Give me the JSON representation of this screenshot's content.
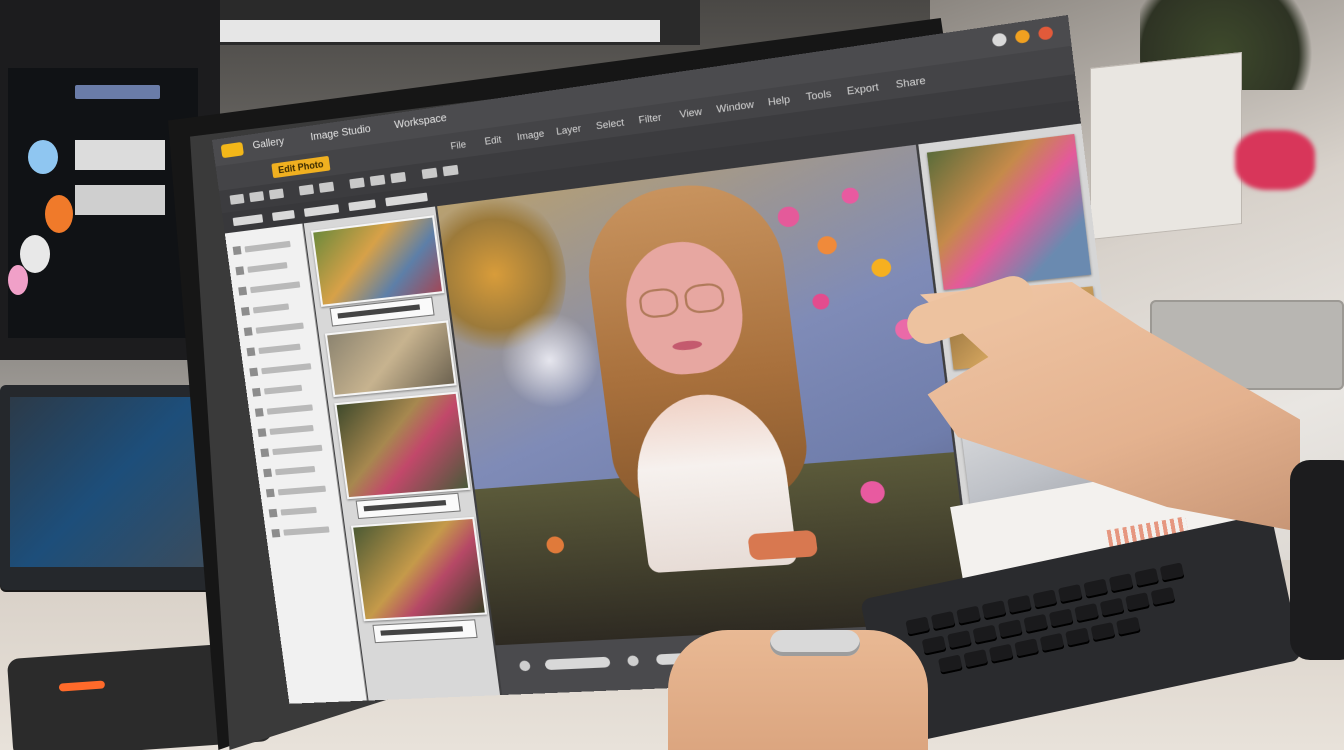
{
  "app": {
    "title_items": [
      "Gallery",
      "Image Studio",
      "Workspace"
    ],
    "menu_tag": "Edit Photo",
    "menu_items": [
      "File",
      "Edit",
      "Image",
      "Layer",
      "Select",
      "Filter",
      "View",
      "Window",
      "Help",
      "Tools",
      "Export",
      "Share"
    ],
    "accent": "#f3b719"
  },
  "icons": [
    "logo-icon",
    "minimize-icon",
    "maximize-icon",
    "close-icon"
  ],
  "colors": {
    "brand_yellow": "#f3b719",
    "panel_dark": "#3f3f41",
    "panel_light": "#f1f1f1"
  }
}
